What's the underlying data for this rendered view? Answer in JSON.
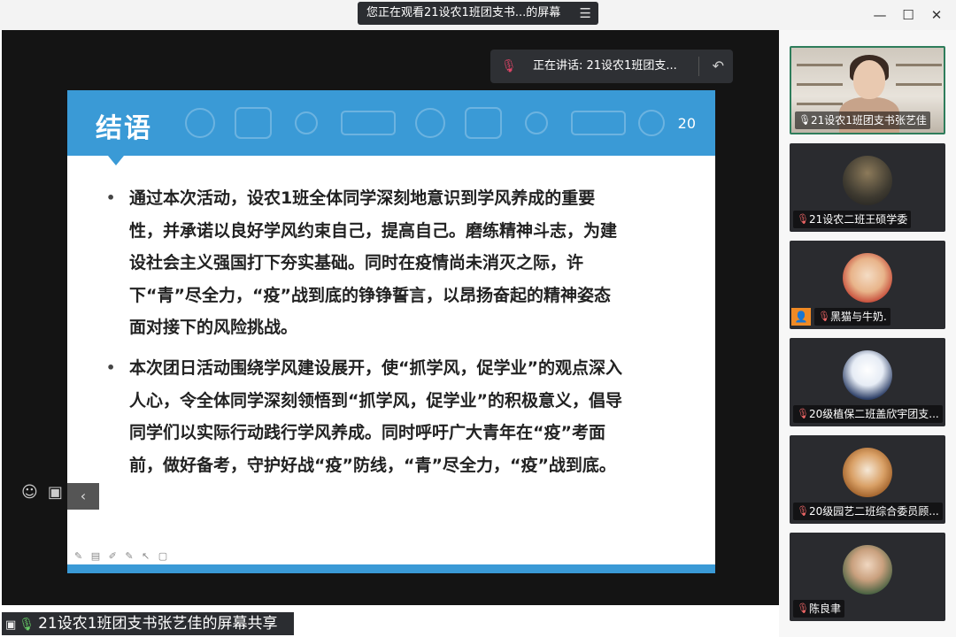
{
  "window": {
    "watch_banner": "您正在观看21设农1班团支书...的屏幕",
    "menu_icon": "menu-icon",
    "controls": [
      "minimize-icon",
      "maximize-icon",
      "close-icon"
    ]
  },
  "speaking": {
    "label": "正在讲话: 21设农1班团支...",
    "mic_icon": "mic-muted-icon",
    "back_icon": "back-arrow-icon"
  },
  "slide": {
    "title": "结语",
    "page_number": "20",
    "bullets": [
      "通过本次活动，设农1班全体同学深刻地意识到学风养成的重要性，并承诺以良好学风约束自己，提高自己。磨练精神斗志，为建设社会主义强国打下夯实基础。同时在疫情尚未消灭之际，许下“青”尽全力，“疫”战到底的铮铮誓言，以昂扬奋起的精神姿态面对接下的风险挑战。",
      "本次团日活动围绕学风建设展开，使“抓学风，促学业”的观点深入人心，令全体同学深刻领悟到“抓学风，促学业”的积极意义，倡导同学们以实际行动践行学风养成。同时呼吁广大青年在“疫”考面前，做好备考，守护好战“疫”防线，“青”尽全力，“疫”战到底。"
    ],
    "header_color": "#3a9ad6"
  },
  "share_bar": {
    "label": "21设农1班团支书张艺佳的屏幕共享"
  },
  "participants": [
    {
      "name": "21设农1班团支书张艺佳",
      "active": true
    },
    {
      "name": "21设农二班王硕学委",
      "active": false
    },
    {
      "name": "黑猫与牛奶.",
      "active": false
    },
    {
      "name": "20级植保二班盖欣宇团支...",
      "active": false
    },
    {
      "name": "20级园艺二班综合委员顾...",
      "active": false
    },
    {
      "name": "陈良聿",
      "active": false
    }
  ]
}
